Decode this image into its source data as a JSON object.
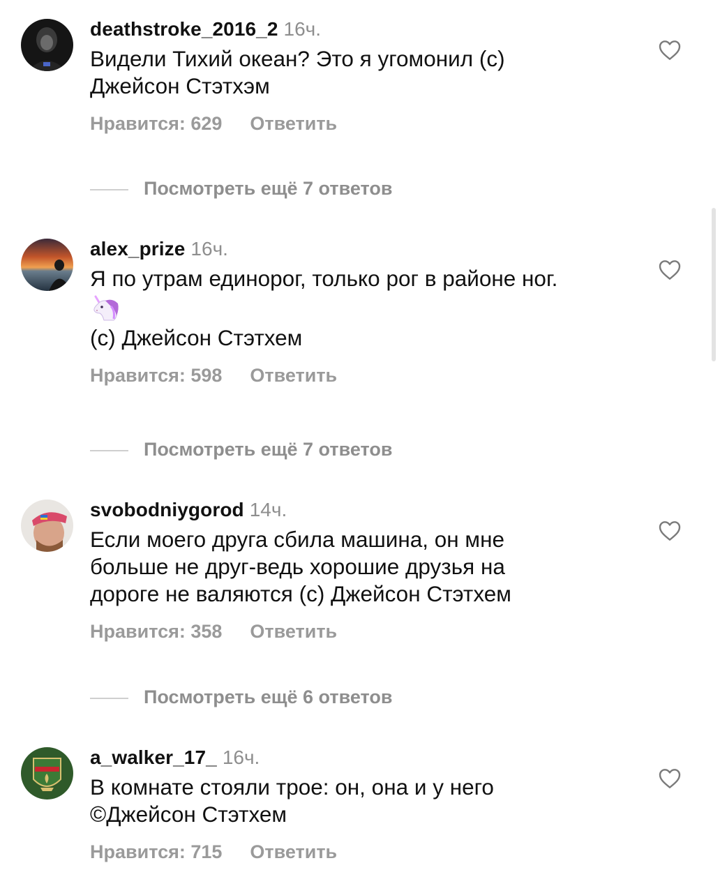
{
  "comments": [
    {
      "username": "deathstroke_2016_2",
      "time": "16ч.",
      "lines": [
        "Видели Тихий океан? Это я угомонил (с)",
        "Джейсон Стэтхэм"
      ],
      "likes": "Нравится: 629",
      "reply": "Ответить",
      "more_replies": "Посмотреть ещё 7 ответов"
    },
    {
      "username": "alex_prize",
      "time": "16ч.",
      "lines": [
        "Я по утрам единорог, только рог в районе ног.",
        "(с) Джейсон Стэтхем"
      ],
      "emoji": "unicorn-emoji",
      "likes": "Нравится: 598",
      "reply": "Ответить",
      "more_replies": "Посмотреть ещё 7 ответов"
    },
    {
      "username": "svobodniygorod",
      "time": "14ч.",
      "lines": [
        "Если моего друга сбила машина, он мне",
        "больше не друг-ведь хорошие друзья на",
        "дороге не валяются (с) Джейсон Стэтхем"
      ],
      "likes": "Нравится: 358",
      "reply": "Ответить",
      "more_replies": "Посмотреть ещё 6 ответов"
    },
    {
      "username": "a_walker_17_",
      "time": "16ч.",
      "lines": [
        "В комнате стояли трое: он, она и у него",
        "©Джейсон Стэтхем"
      ],
      "likes": "Нравится: 715",
      "reply": "Ответить"
    }
  ],
  "icons": {
    "like": "heart-icon"
  },
  "colors": {
    "text": "#111111",
    "muted": "#8e8e8e",
    "background": "#ffffff"
  }
}
